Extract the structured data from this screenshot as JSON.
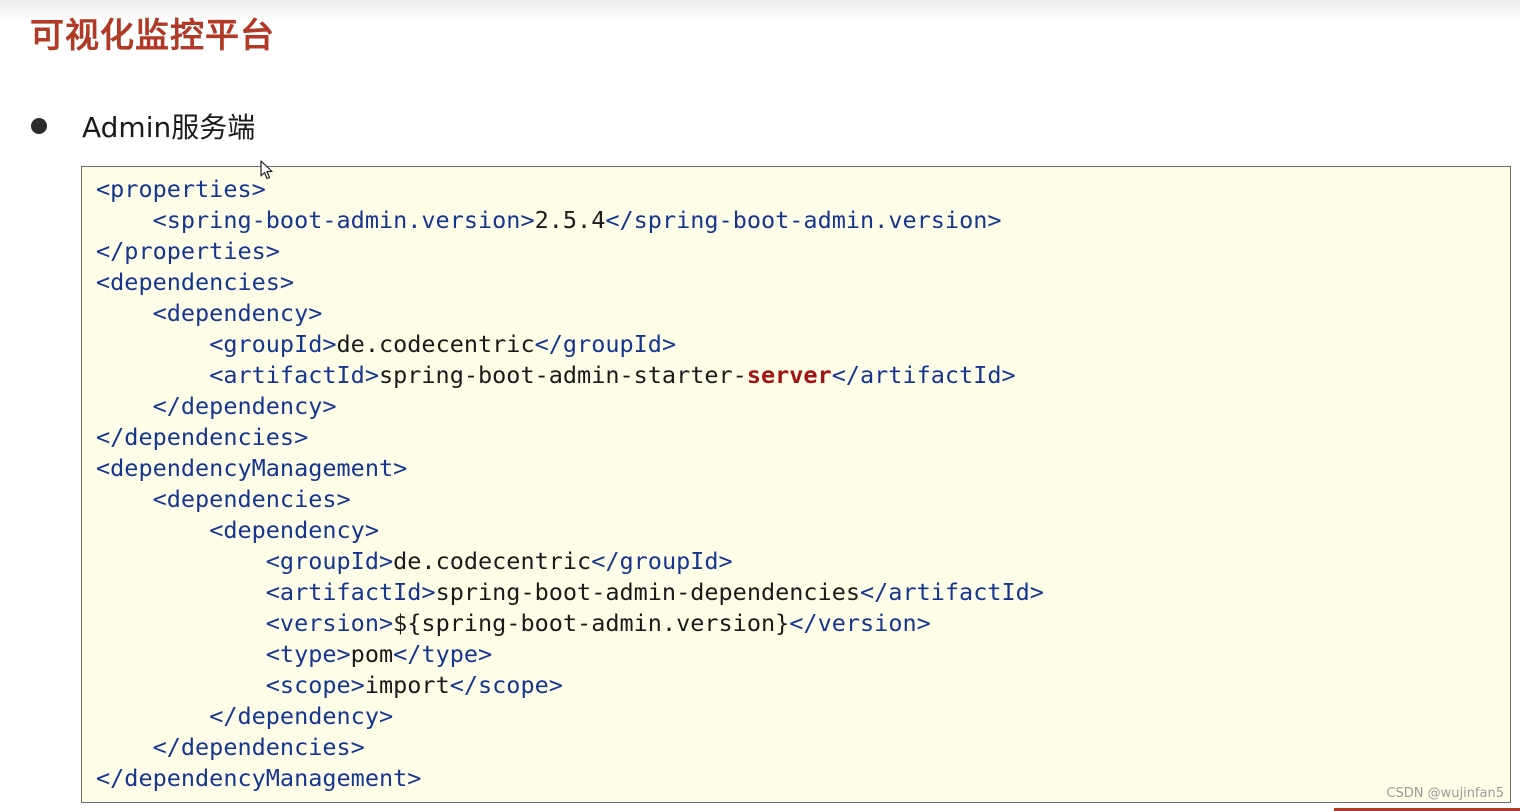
{
  "slide": {
    "title": "可视化监控平台",
    "bullet": "Admin服务端",
    "watermark": "CSDN @wujinfan5"
  },
  "colors": {
    "title": "#b03a26",
    "code_background": "#fefee8",
    "tag": "#16358f",
    "text": "#1a1a1a",
    "highlight": "#a31515"
  },
  "code": {
    "language": "xml",
    "lines": [
      [
        {
          "t": "tag",
          "v": "<properties>"
        }
      ],
      [
        {
          "t": "txt",
          "v": "    "
        },
        {
          "t": "tag",
          "v": "<spring-boot-admin.version>"
        },
        {
          "t": "txt",
          "v": "2.5.4"
        },
        {
          "t": "tag",
          "v": "</spring-boot-admin.version>"
        }
      ],
      [
        {
          "t": "tag",
          "v": "</properties>"
        }
      ],
      [
        {
          "t": "tag",
          "v": "<dependencies>"
        }
      ],
      [
        {
          "t": "txt",
          "v": "    "
        },
        {
          "t": "tag",
          "v": "<dependency>"
        }
      ],
      [
        {
          "t": "txt",
          "v": "        "
        },
        {
          "t": "tag",
          "v": "<groupId>"
        },
        {
          "t": "txt",
          "v": "de.codecentric"
        },
        {
          "t": "tag",
          "v": "</groupId>"
        }
      ],
      [
        {
          "t": "txt",
          "v": "        "
        },
        {
          "t": "tag",
          "v": "<artifactId>"
        },
        {
          "t": "txt",
          "v": "spring-boot-admin-starter-"
        },
        {
          "t": "hl",
          "v": "server"
        },
        {
          "t": "tag",
          "v": "</artifactId>"
        }
      ],
      [
        {
          "t": "txt",
          "v": "    "
        },
        {
          "t": "tag",
          "v": "</dependency>"
        }
      ],
      [
        {
          "t": "tag",
          "v": "</dependencies>"
        }
      ],
      [
        {
          "t": "tag",
          "v": "<dependencyManagement>"
        }
      ],
      [
        {
          "t": "txt",
          "v": "    "
        },
        {
          "t": "tag",
          "v": "<dependencies>"
        }
      ],
      [
        {
          "t": "txt",
          "v": "        "
        },
        {
          "t": "tag",
          "v": "<dependency>"
        }
      ],
      [
        {
          "t": "txt",
          "v": "            "
        },
        {
          "t": "tag",
          "v": "<groupId>"
        },
        {
          "t": "txt",
          "v": "de.codecentric"
        },
        {
          "t": "tag",
          "v": "</groupId>"
        }
      ],
      [
        {
          "t": "txt",
          "v": "            "
        },
        {
          "t": "tag",
          "v": "<artifactId>"
        },
        {
          "t": "txt",
          "v": "spring-boot-admin-dependencies"
        },
        {
          "t": "tag",
          "v": "</artifactId>"
        }
      ],
      [
        {
          "t": "txt",
          "v": "            "
        },
        {
          "t": "tag",
          "v": "<version>"
        },
        {
          "t": "txt",
          "v": "${spring-boot-admin.version}"
        },
        {
          "t": "tag",
          "v": "</version>"
        }
      ],
      [
        {
          "t": "txt",
          "v": "            "
        },
        {
          "t": "tag",
          "v": "<type>"
        },
        {
          "t": "txt",
          "v": "pom"
        },
        {
          "t": "tag",
          "v": "</type>"
        }
      ],
      [
        {
          "t": "txt",
          "v": "            "
        },
        {
          "t": "tag",
          "v": "<scope>"
        },
        {
          "t": "txt",
          "v": "import"
        },
        {
          "t": "tag",
          "v": "</scope>"
        }
      ],
      [
        {
          "t": "txt",
          "v": "        "
        },
        {
          "t": "tag",
          "v": "</dependency>"
        }
      ],
      [
        {
          "t": "txt",
          "v": "    "
        },
        {
          "t": "tag",
          "v": "</dependencies>"
        }
      ],
      [
        {
          "t": "tag",
          "v": "</dependencyManagement>"
        }
      ]
    ]
  },
  "icons": {
    "bullet": "bullet-dot-icon",
    "cursor": "mouse-pointer-icon"
  }
}
